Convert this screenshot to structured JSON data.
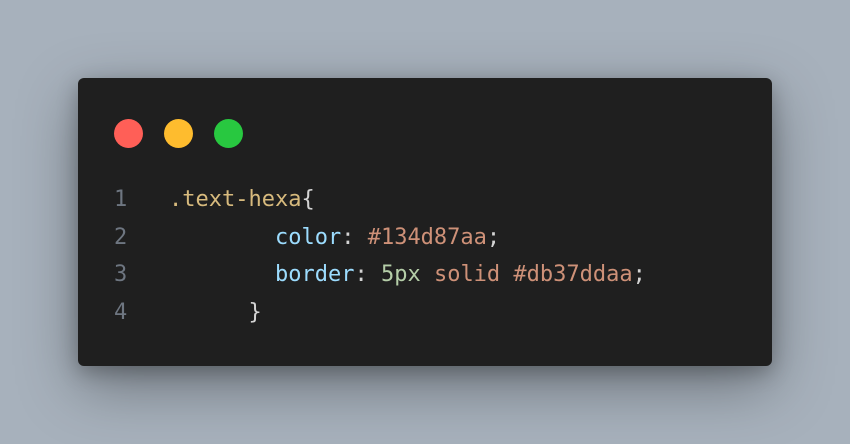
{
  "colors": {
    "background": "#a7b1bc",
    "editor_bg": "#1f1f1f",
    "dot_close": "#ff5f57",
    "dot_minimize": "#febc2e",
    "dot_maximize": "#28c840",
    "line_number": "#6e7681",
    "selector": "#d7ba7d",
    "property": "#9cdcfe",
    "punctuation": "#d4d4d4",
    "string_value": "#ce9178",
    "number_value": "#b5cea8"
  },
  "window_controls": [
    {
      "name": "close-dot",
      "color": "#ff5f57"
    },
    {
      "name": "minimize-dot",
      "color": "#febc2e"
    },
    {
      "name": "maximize-dot",
      "color": "#28c840"
    }
  ],
  "code": {
    "lines": [
      {
        "number": "1",
        "indent": "",
        "tokens": [
          {
            "text": ".text-hexa",
            "kind": "selector"
          },
          {
            "text": "{",
            "kind": "punctuation"
          }
        ]
      },
      {
        "number": "2",
        "indent": "        ",
        "tokens": [
          {
            "text": "color",
            "kind": "property"
          },
          {
            "text": ": ",
            "kind": "punctuation"
          },
          {
            "text": "#134d87aa",
            "kind": "string_value"
          },
          {
            "text": ";",
            "kind": "punctuation"
          }
        ]
      },
      {
        "number": "3",
        "indent": "        ",
        "tokens": [
          {
            "text": "border",
            "kind": "property"
          },
          {
            "text": ": ",
            "kind": "punctuation"
          },
          {
            "text": "5px",
            "kind": "number_value"
          },
          {
            "text": " solid #db37ddaa",
            "kind": "string_value"
          },
          {
            "text": ";",
            "kind": "punctuation"
          }
        ]
      },
      {
        "number": "4",
        "indent": "      ",
        "tokens": [
          {
            "text": "}",
            "kind": "punctuation"
          }
        ]
      }
    ]
  }
}
